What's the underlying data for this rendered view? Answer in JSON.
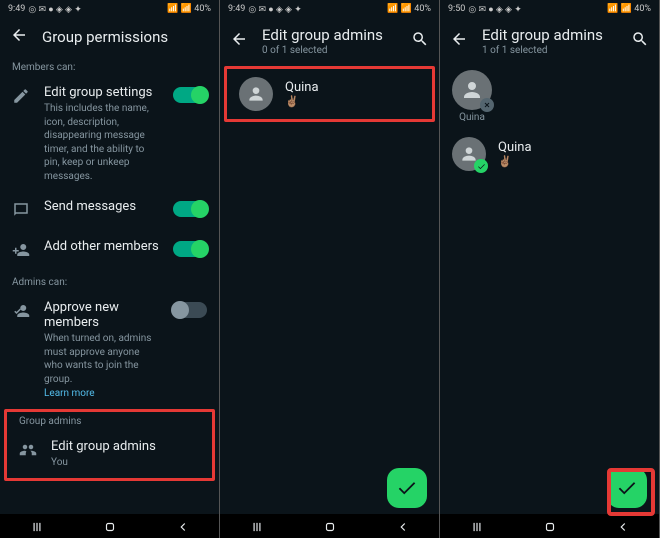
{
  "status": {
    "time_a": "9:49",
    "time_b": "9:49",
    "time_c": "9:50",
    "icons_left": "◎ ✉ ● ◈ ◈ ✦",
    "icons_right": "📶 📶 40%",
    "battery": "40%"
  },
  "screen1": {
    "title": "Group permissions",
    "members_can": "Members can:",
    "edit_settings": {
      "title": "Edit group settings",
      "desc": "This includes the name, icon, description, disappearing message timer, and the ability to pin, keep or unkeep messages."
    },
    "send_messages": "Send messages",
    "add_members": "Add other members",
    "admins_can": "Admins can:",
    "approve": {
      "title": "Approve new members",
      "desc": "When turned on, admins must approve anyone who wants to join the group.",
      "link": "Learn more"
    },
    "group_admins_label": "Group admins",
    "edit_admins": {
      "title": "Edit group admins",
      "sub": "You"
    }
  },
  "screen2": {
    "title": "Edit group admins",
    "sub": "0 of 1 selected",
    "member": {
      "name": "Quina",
      "status": "✌🏽"
    }
  },
  "screen3": {
    "title": "Edit group admins",
    "sub": "1 of 1 selected",
    "selected": {
      "name": "Quina"
    },
    "member": {
      "name": "Quina",
      "status": "✌🏽"
    }
  }
}
